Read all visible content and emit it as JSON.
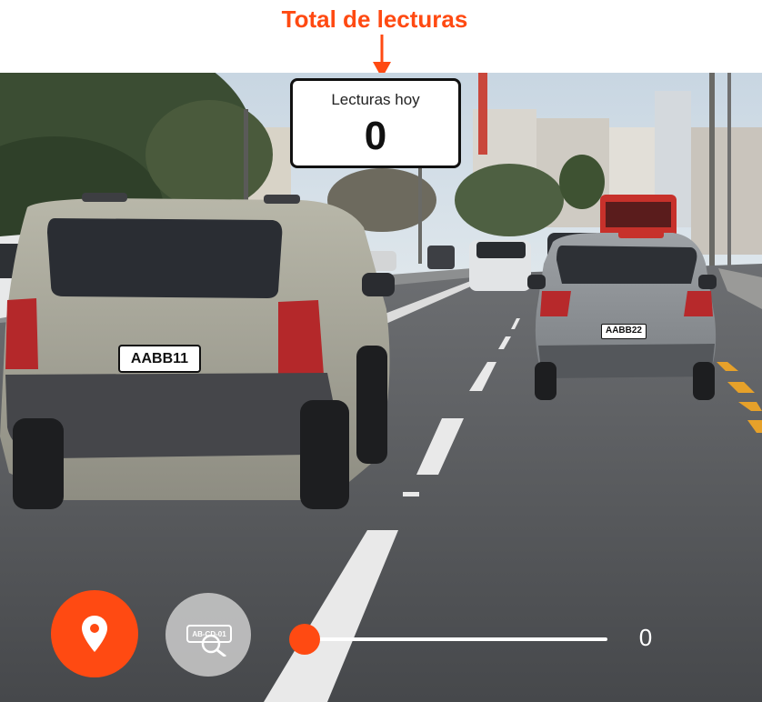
{
  "annotation": {
    "title": "Total de lecturas",
    "color": "#ff4a12"
  },
  "readings_card": {
    "label": "Lecturas hoy",
    "count": "0"
  },
  "plates": {
    "front_vehicle": "AABB11",
    "ahead_vehicle": "AABB22"
  },
  "controls": {
    "location_button": {
      "icon": "map-pin-icon",
      "color": "#ff4a12"
    },
    "plate_search_button": {
      "icon": "plate-search-icon",
      "label": "AB-CD-01"
    },
    "slider": {
      "value": "0",
      "fraction": 0
    }
  }
}
